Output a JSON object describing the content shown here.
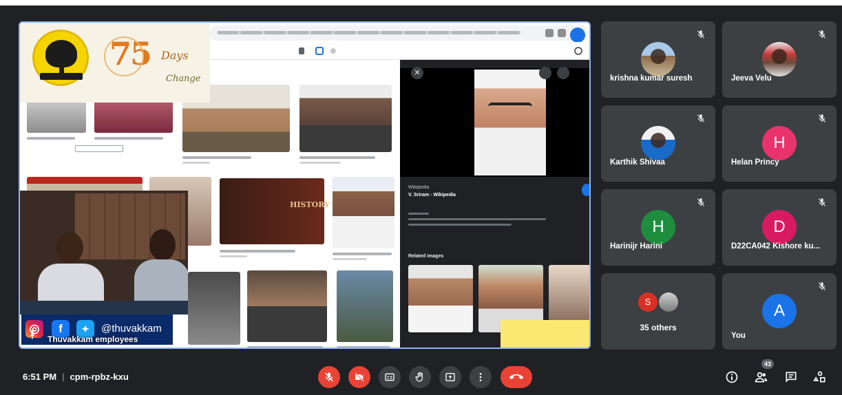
{
  "presentation": {
    "speaker_label": "Thuvakkam employees",
    "social_handle": "@thuvakkam",
    "logo": {
      "days_text": "Days",
      "change_text": "Change",
      "number": "75"
    },
    "search_panel": {
      "source": "Wikipedia",
      "title": "V. Sriram - Wikipedia",
      "related_label": "Related images"
    }
  },
  "participants": [
    {
      "name": "krishna kumar suresh",
      "type": "photo",
      "muted": true
    },
    {
      "name": "Jeeva Velu",
      "type": "photo",
      "muted": true
    },
    {
      "name": "Karthik Shivaa",
      "type": "photo",
      "muted": true
    },
    {
      "name": "Helan Princy",
      "initial": "H",
      "color": "#e8336d",
      "muted": true
    },
    {
      "name": "Harinijr Harini",
      "initial": "H",
      "color": "#1e8e3e",
      "muted": true
    },
    {
      "name": "D22CA042 Kishore ku...",
      "initial": "D",
      "color": "#d81b60",
      "muted": true
    },
    {
      "name": "35 others",
      "initial": "S",
      "color": "#d93025",
      "muted": false
    },
    {
      "name": "You",
      "initial": "A",
      "color": "#1a73e8",
      "muted": true
    }
  ],
  "meeting": {
    "time": "6:51 PM",
    "code": "cpm-rpbz-kxu",
    "participant_count": "43"
  },
  "controls": {
    "mic": "mic-off-icon",
    "camera": "camera-off-icon",
    "captions": "captions-icon",
    "raise_hand": "hand-icon",
    "present": "present-icon",
    "more": "more-vert-icon",
    "end_call": "end-call-icon"
  },
  "colors": {
    "background": "#202124",
    "tile": "#3c4043",
    "danger": "#ea4335",
    "accent": "#8ab4f8"
  }
}
